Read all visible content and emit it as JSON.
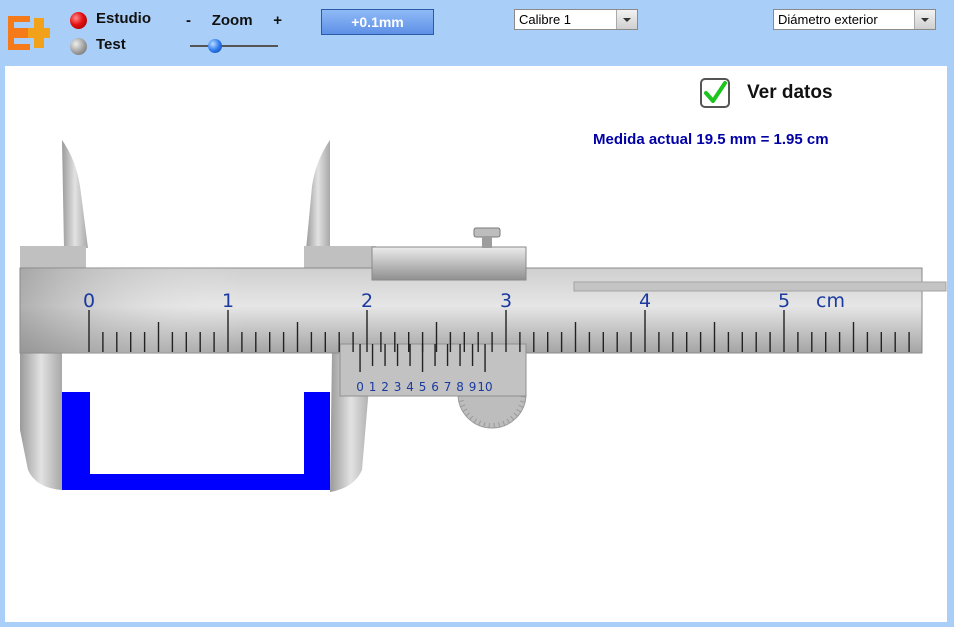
{
  "toolbar": {
    "mode_options": [
      {
        "label": "Estudio",
        "selected": true
      },
      {
        "label": "Test",
        "selected": false
      }
    ],
    "zoom": {
      "minus": "-",
      "label": "Zoom",
      "plus": "+",
      "level": 0.2
    },
    "precision_button": "+0.1mm",
    "instrument_select": {
      "selected": "Calibre 1"
    },
    "measure_type_select": {
      "selected": "Diámetro exterior"
    }
  },
  "canvas": {
    "show_data": {
      "label": "Ver datos",
      "checked": true
    },
    "measurement": "Medida actual 19.5 mm = 1.95 cm",
    "main_scale": {
      "labels": [
        "0",
        "1",
        "2",
        "3",
        "4",
        "5"
      ],
      "unit": "cm",
      "max_mm": 59
    },
    "vernier_scale": {
      "labels": [
        "0",
        "1",
        "2",
        "3",
        "4",
        "5",
        "6",
        "7",
        "8",
        "9",
        "10"
      ]
    },
    "reading_mm": 19.5
  },
  "colors": {
    "toolbar_bg": "#a9cef7",
    "scale_text": "#1a3aa0",
    "measurement_text": "#0000a6",
    "object": "#0000ff",
    "check": "#1ec41e"
  }
}
